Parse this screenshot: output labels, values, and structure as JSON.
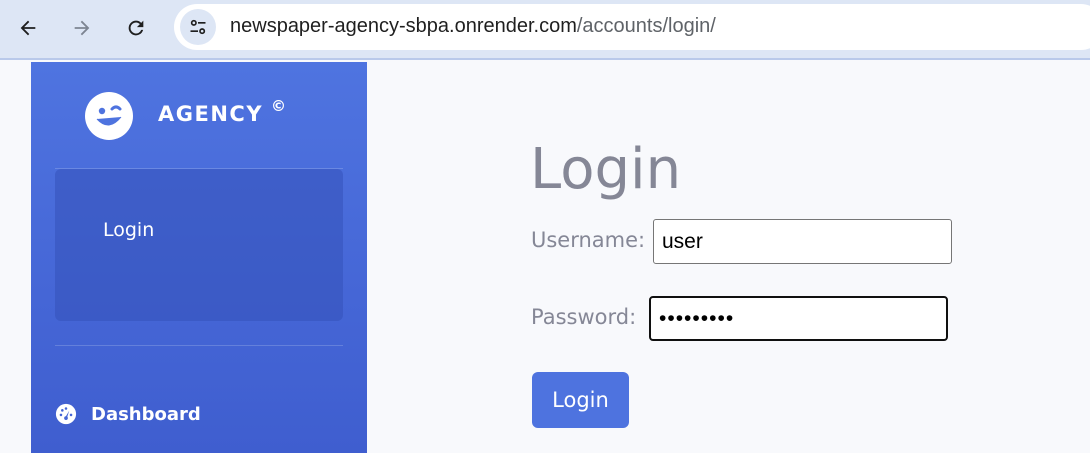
{
  "browser": {
    "url_host": "newspaper-agency-sbpa.onrender.com",
    "url_path": "/accounts/login/",
    "back_icon": "arrow-left-icon",
    "forward_icon": "arrow-right-icon",
    "reload_icon": "reload-icon",
    "site_info_icon": "tune-icon"
  },
  "sidebar": {
    "brand": "AGENCY",
    "brand_mark": "©",
    "logo_icon": "winking-face-icon",
    "items": [
      {
        "label": "Login",
        "active": true
      },
      {
        "label": "Dashboard",
        "icon": "tachometer-icon"
      }
    ],
    "background_color": "#4e73df"
  },
  "main": {
    "title": "Login",
    "username_label": "Username:",
    "username_value": "user",
    "password_label": "Password:",
    "password_value": "•••••••••",
    "submit_label": "Login",
    "accent_color": "#4e73df"
  }
}
